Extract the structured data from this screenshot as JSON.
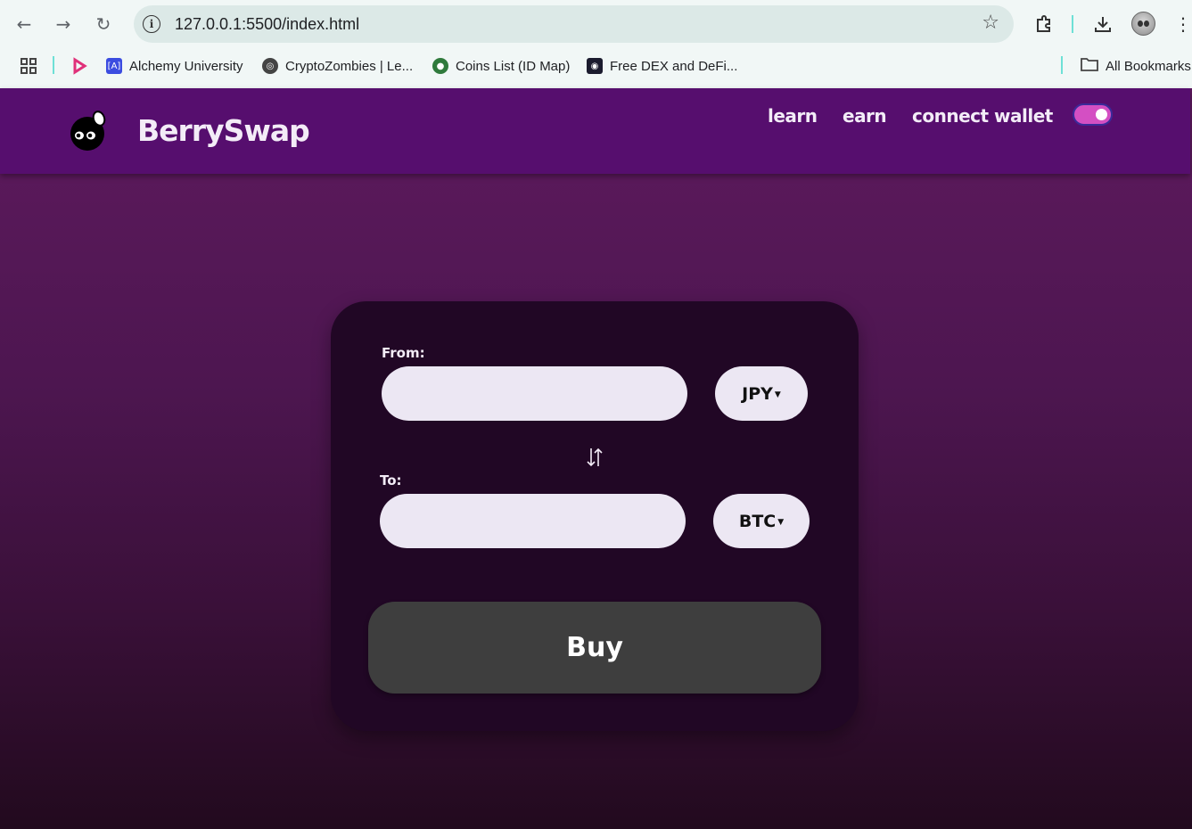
{
  "browser": {
    "url": "127.0.0.1:5500/index.html",
    "bookmarks": [
      {
        "label": "Alchemy University",
        "icon": "alchemy-icon"
      },
      {
        "label": "CryptoZombies | Le...",
        "icon": "globe-icon"
      },
      {
        "label": "Coins List (ID Map)",
        "icon": "earth-icon"
      },
      {
        "label": "Free DEX and DeFi...",
        "icon": "dex-icon"
      }
    ],
    "all_bookmarks": "All Bookmarks"
  },
  "header": {
    "brand": "BerrySwap",
    "nav": [
      "learn",
      "earn",
      "connect wallet"
    ],
    "theme_toggle_on": true
  },
  "swap": {
    "from_label": "From:",
    "from_currency": "JPY",
    "from_value": "",
    "to_label": "To:",
    "to_currency": "BTC",
    "to_value": "",
    "buy_label": "Buy"
  },
  "colors": {
    "header_bg": "#560e6e",
    "card_bg": "#210725",
    "input_bg": "#ece7f3",
    "buy_bg": "#3e3e3e",
    "toggle_accent": "#d44fc3"
  }
}
